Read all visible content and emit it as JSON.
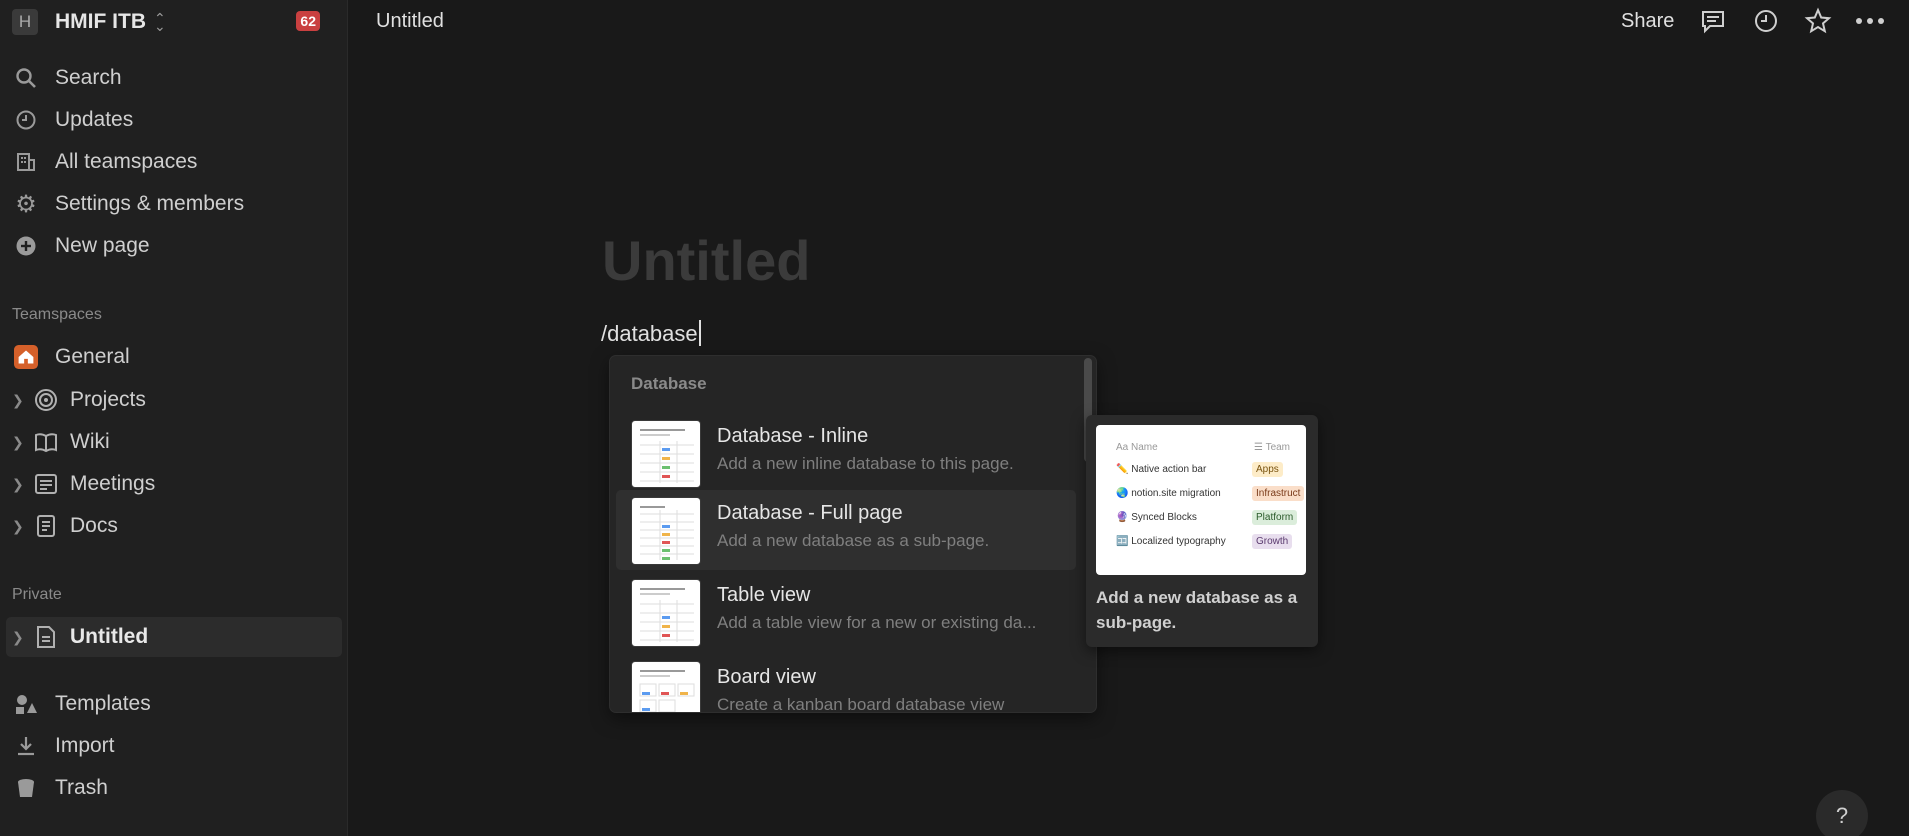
{
  "workspace": {
    "avatar": "H",
    "name": "HMIF ITB",
    "badge": "62"
  },
  "sidebar": {
    "nav": [
      {
        "label": "Search",
        "icon": "search-icon"
      },
      {
        "label": "Updates",
        "icon": "clock-icon"
      },
      {
        "label": "All teamspaces",
        "icon": "building-icon"
      },
      {
        "label": "Settings & members",
        "icon": "gear-icon"
      },
      {
        "label": "New page",
        "icon": "plus-circle-icon"
      }
    ],
    "teamspaces_label": "Teamspaces",
    "teamspaces": [
      {
        "label": "General",
        "icon": "home-icon"
      },
      {
        "label": "Projects",
        "icon": "target-icon"
      },
      {
        "label": "Wiki",
        "icon": "book-icon"
      },
      {
        "label": "Meetings",
        "icon": "notes-icon"
      },
      {
        "label": "Docs",
        "icon": "doc-icon"
      }
    ],
    "private_label": "Private",
    "private": [
      {
        "label": "Untitled",
        "icon": "page-icon"
      }
    ],
    "footer": [
      {
        "label": "Templates",
        "icon": "templates-icon"
      },
      {
        "label": "Import",
        "icon": "import-icon"
      },
      {
        "label": "Trash",
        "icon": "trash-icon"
      }
    ]
  },
  "topbar": {
    "title": "Untitled",
    "share": "Share"
  },
  "page": {
    "title_placeholder": "Untitled",
    "command": "/database"
  },
  "menu": {
    "heading": "Database",
    "items": [
      {
        "title": "Database - Inline",
        "desc": "Add a new inline database to this page."
      },
      {
        "title": "Database - Full page",
        "desc": "Add a new database as a sub-page."
      },
      {
        "title": "Table view",
        "desc": "Add a table view for a new or existing da..."
      },
      {
        "title": "Board view",
        "desc": "Create a kanban board database view"
      }
    ]
  },
  "preview": {
    "col_name": "Name",
    "col_team": "Team",
    "rows": [
      {
        "name": "Native action bar",
        "team": "Apps",
        "color": "#fdecc8"
      },
      {
        "name": "notion.site migration",
        "team": "Infrastruct",
        "color": "#fadec9"
      },
      {
        "name": "Synced Blocks",
        "team": "Platform",
        "color": "#dbeddb"
      },
      {
        "name": "Localized typography",
        "team": "Growth",
        "color": "#e8deee"
      }
    ],
    "caption": "Add a new database as a sub-page."
  },
  "help": "?"
}
